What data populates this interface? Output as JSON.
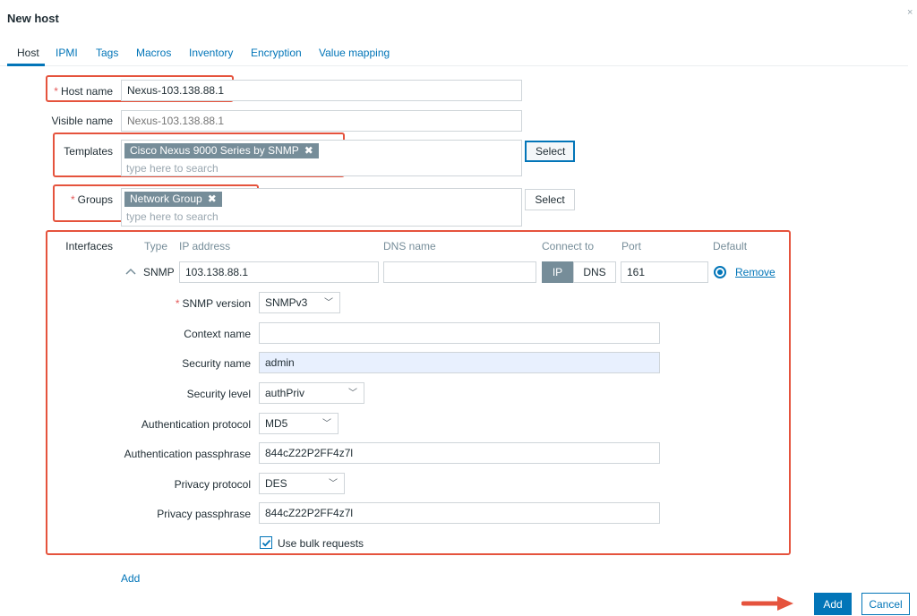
{
  "dialog": {
    "title": "New host",
    "close_glyph": "×"
  },
  "tabs": [
    {
      "label": "Host",
      "active": true
    },
    {
      "label": "IPMI"
    },
    {
      "label": "Tags"
    },
    {
      "label": "Macros"
    },
    {
      "label": "Inventory"
    },
    {
      "label": "Encryption"
    },
    {
      "label": "Value mapping"
    }
  ],
  "required_marker": "*",
  "form": {
    "host_name": {
      "label": "Host name",
      "value": "Nexus-103.138.88.1"
    },
    "visible_name": {
      "label": "Visible name",
      "placeholder": "Nexus-103.138.88.1"
    },
    "templates": {
      "label": "Templates",
      "chips": [
        "Cisco Nexus 9000 Series by SNMP"
      ],
      "placeholder": "type here to search",
      "select_label": "Select"
    },
    "groups": {
      "label": "Groups",
      "chips": [
        "Network Group"
      ],
      "placeholder": "type here to search",
      "select_label": "Select"
    },
    "chip_remove_glyph": "✖"
  },
  "interfaces": {
    "label": "Interfaces",
    "headers": {
      "type": "Type",
      "ip": "IP address",
      "dns": "DNS name",
      "connect": "Connect to",
      "port": "Port",
      "default": "Default"
    },
    "row": {
      "type": "SNMP",
      "ip": "103.138.88.1",
      "dns": "",
      "connect_options": [
        "IP",
        "DNS"
      ],
      "connect_selected": "IP",
      "port": "161",
      "remove_label": "Remove"
    },
    "snmp": {
      "version": {
        "label": "SNMP version",
        "value": "SNMPv3"
      },
      "context_name": {
        "label": "Context name",
        "value": ""
      },
      "security_name": {
        "label": "Security name",
        "value": "admin"
      },
      "security_level": {
        "label": "Security level",
        "value": "authPriv"
      },
      "auth_protocol": {
        "label": "Authentication protocol",
        "value": "MD5"
      },
      "auth_pass": {
        "label": "Authentication passphrase",
        "value": "844cZ22P2FF4z7l"
      },
      "priv_protocol": {
        "label": "Privacy protocol",
        "value": "DES"
      },
      "priv_pass": {
        "label": "Privacy passphrase",
        "value": "844cZ22P2FF4z7l"
      },
      "bulk": {
        "label": "Use bulk requests",
        "checked": true
      }
    },
    "add_label": "Add"
  },
  "footer": {
    "add_label": "Add",
    "cancel_label": "Cancel"
  },
  "colors": {
    "accent": "#0275b8",
    "highlight_box": "#e5533d",
    "chip": "#768d99",
    "required": "#e45959"
  },
  "icons": {
    "collapse": "chevron-up-icon",
    "dropdown": "chevron-down-icon",
    "check": "checkmark-icon",
    "annotation": "right-arrow-icon"
  }
}
